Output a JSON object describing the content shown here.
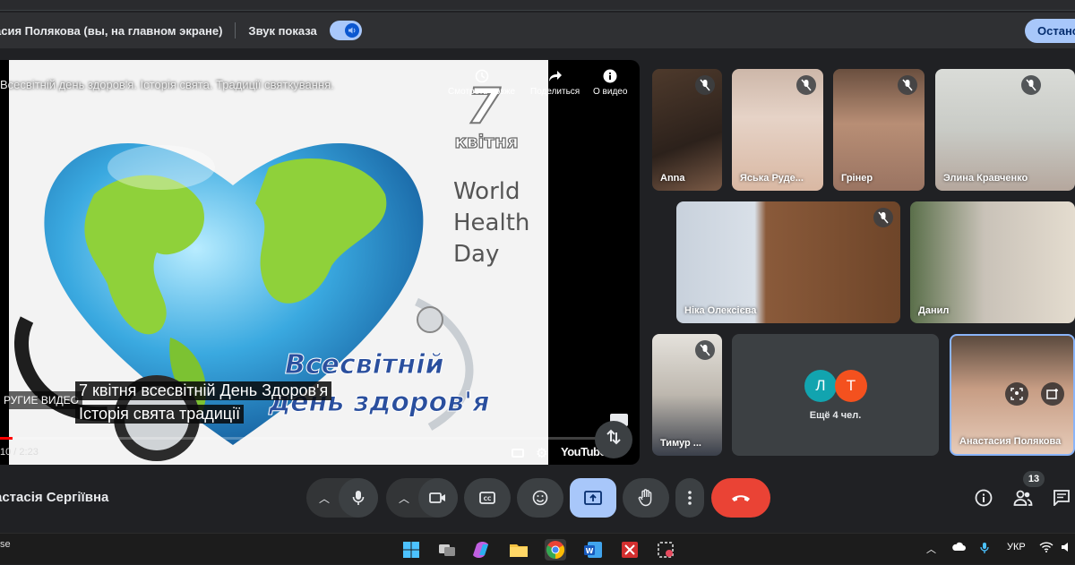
{
  "sharebar": {
    "presenter_label": "асия Полякова (вы, на главном экране)",
    "sound_label": "Звук показа",
    "stop_label": "Остано"
  },
  "main_video": {
    "youtube_title": "Всесвітній день здоров'я. Історія свята. Традиції святкування.",
    "watch_later_label": "Смотреть позже",
    "share_label": "Поделиться",
    "about_label": "О видео",
    "other_videos_label": "РУГИЕ ВИДЕО",
    "caption_line1": "7 квітня всесвітній День Здоров'я",
    "caption_line2": "Історія свята традиції",
    "time": "10 / 2:23",
    "progress": 0.02,
    "youtube_logo": "YouTube",
    "slide": {
      "day_number": "7",
      "month": "квітня",
      "en_line1": "World",
      "en_line2": "Health",
      "en_line3": "Day",
      "ua_line1": "Всесвітній",
      "ua_line2": "день здоров'я"
    }
  },
  "participants": [
    {
      "name": "Anna",
      "muted": true
    },
    {
      "name": "Яська Руде...",
      "muted": true
    },
    {
      "name": "Грінер",
      "muted": true
    },
    {
      "name": "Элина Кравченко",
      "muted": true
    },
    {
      "name": "Ніка Олексієва",
      "muted": true
    },
    {
      "name": "Данил",
      "muted": false
    },
    {
      "name": "Тимур ...",
      "muted": true
    },
    {
      "name": "Анастасия Полякова",
      "muted": false
    }
  ],
  "more_tile": {
    "avatar1": "Л",
    "avatar2": "Т",
    "label": "Ещё 4 чел.",
    "avatar1_color": "#12a4af",
    "avatar2_color": "#f4511e"
  },
  "controls": {
    "meeting_user": "астасія Сергіївна",
    "participants_count": "13",
    "present_color": "#a8c7fa",
    "leave_color": "#ea4335"
  },
  "taskbar": {
    "left_text": "se",
    "lang": "УКР"
  }
}
